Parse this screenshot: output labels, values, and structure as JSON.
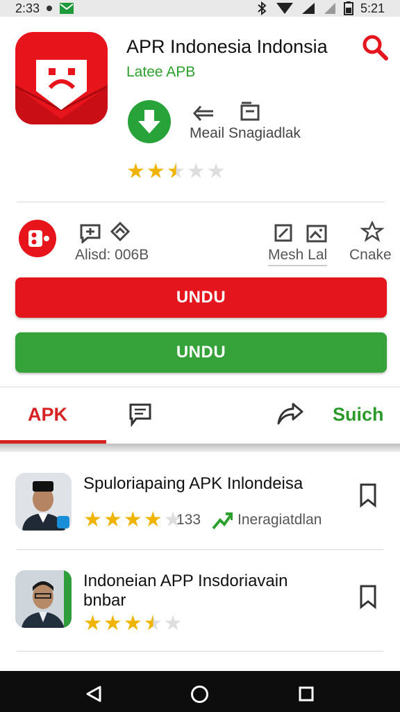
{
  "status_bar": {
    "time_left": "2:33",
    "time_right": "5:21"
  },
  "app": {
    "title": "APR Indonesia Indonsia",
    "subtitle": "Latee APB",
    "action_label": "Meail Snagiadlak",
    "rating_stars": 2.5
  },
  "actions": {
    "left_label": "Alisd: 006B",
    "mid_label": "Mesh Lal",
    "right_label": "Cnake"
  },
  "buttons": {
    "primary": "UNDU",
    "secondary": "UNDU"
  },
  "tabs": {
    "apk": "APK",
    "suich": "Suich"
  },
  "list": [
    {
      "title": "Spuloriapaing APK Inlondeisa",
      "rating_stars": 4,
      "count": "133",
      "tag": "Ineragiatdlan"
    },
    {
      "title": "Indoneian APP Insdoriavain bnbar",
      "rating_stars": 3.5
    }
  ],
  "colors": {
    "red": "#e4151c",
    "green": "#35a23a",
    "star": "#f0b400"
  }
}
